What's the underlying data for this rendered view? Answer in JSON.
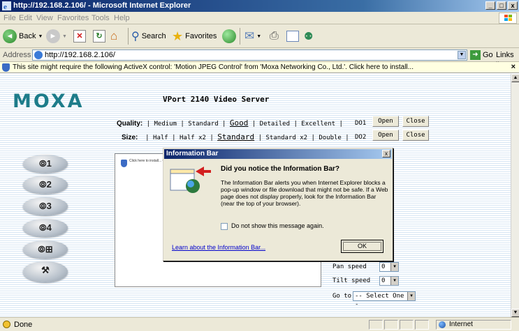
{
  "window": {
    "title": "http://192.168.2.106/ - Microsoft Internet Explorer",
    "min": "_",
    "max": "□",
    "close": "x"
  },
  "menu": [
    "File",
    "Edit",
    "View",
    "Favorites",
    "Tools",
    "Help"
  ],
  "toolbar": {
    "back": "Back",
    "search": "Search",
    "favorites": "Favorites"
  },
  "address": {
    "label": "Address",
    "url": "http://192.168.2.106/",
    "go": "Go",
    "links": "Links"
  },
  "infobar": {
    "text": "This site might require the following ActiveX control: 'Motion JPEG Control' from 'Moxa Networking Co., Ltd.'. Click here to install...",
    "close": "×"
  },
  "page": {
    "logo": "MOXA",
    "title": "VPort 2140 Video Server",
    "quality_label": "Quality:",
    "quality_options": [
      "Medium",
      "Standard",
      "Good",
      "Detailed",
      "Excellent"
    ],
    "quality_selected": "Good",
    "size_label": "Size:",
    "size_options": [
      "Half",
      "Half x2",
      "Standard",
      "Standard x2",
      "Double"
    ],
    "size_selected": "Standard",
    "do1_label": "DO1",
    "do2_label": "DO2",
    "open_label": "Open",
    "close_label": "Close",
    "camera_buttons": [
      "1",
      "2",
      "3",
      "4"
    ],
    "video_frame_text": "Click here to install... Co., Ltd.'...",
    "pan_speed_label": "Pan speed",
    "pan_speed_value": "0",
    "tilt_speed_label": "Tilt speed",
    "tilt_speed_value": "0",
    "goto_label": "Go to",
    "goto_value": "-- Select One --"
  },
  "dialog": {
    "title": "Information Bar",
    "close": "x",
    "heading": "Did you notice the Information Bar?",
    "body": "The Information Bar alerts you when Internet Explorer blocks a pop-up window or file download that might not be safe. If a Web page does not display properly, look for the Information Bar (near the top of your browser).",
    "checkbox_label": "Do not show this message again.",
    "learn_link": "Learn about the Information Bar...",
    "ok": "OK"
  },
  "status": {
    "text": "Done",
    "zone": "Internet"
  },
  "colors": {
    "moxa_teal": "#1d7c8a",
    "titlebar": "#0a246a",
    "infobar_bg": "#ffffe1",
    "chrome": "#ece9d8"
  }
}
